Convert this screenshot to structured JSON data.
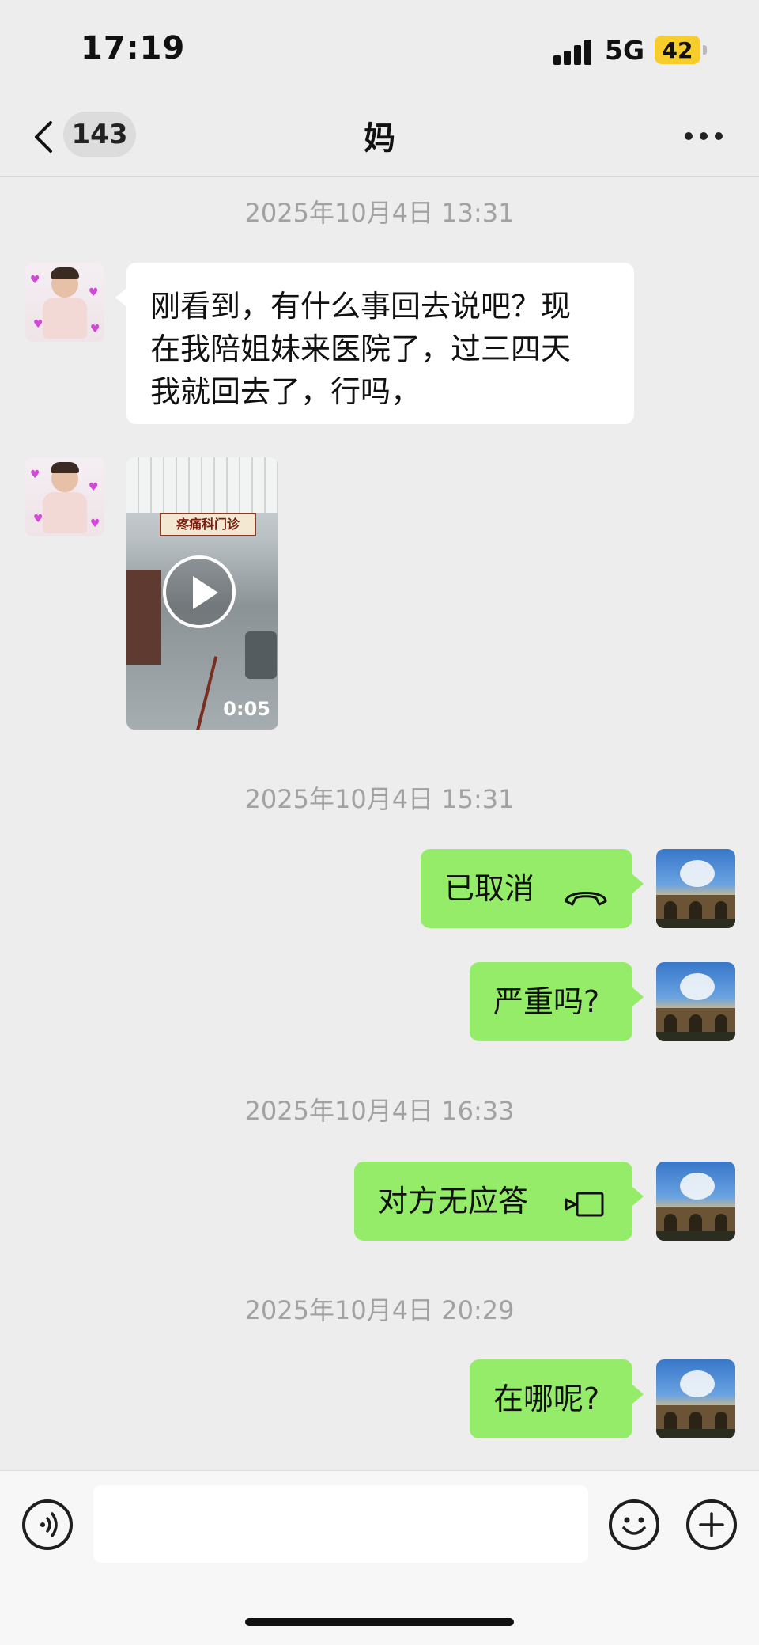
{
  "status_bar": {
    "time": "17:19",
    "network": "5G",
    "battery": "42"
  },
  "header": {
    "unread_count": "143",
    "title": "妈"
  },
  "messages": [
    {
      "type": "timestamp",
      "text": "2025年10月4日 13:31"
    },
    {
      "type": "text",
      "side": "left",
      "text": "刚看到，有什么事回去说吧？现\n在我陪姐妹来医院了，过三四天\n我就回去了，行吗，"
    },
    {
      "type": "video",
      "side": "left",
      "sign_text": "疼痛科门诊",
      "duration": "0:05"
    },
    {
      "type": "timestamp",
      "text": "2025年10月4日 15:31"
    },
    {
      "type": "call",
      "side": "right",
      "text": "已取消",
      "icon": "phone-hangup-icon"
    },
    {
      "type": "text",
      "side": "right",
      "text": "严重吗?"
    },
    {
      "type": "timestamp",
      "text": "2025年10月4日 16:33"
    },
    {
      "type": "call",
      "side": "right",
      "text": "对方无应答",
      "icon": "video-call-icon"
    },
    {
      "type": "timestamp",
      "text": "2025年10月4日 20:29"
    },
    {
      "type": "text",
      "side": "right",
      "text": "在哪呢?"
    }
  ],
  "input_bar": {
    "placeholder": "",
    "value": ""
  },
  "colors": {
    "background": "#ededed",
    "outgoing_bubble": "#95ec69",
    "incoming_bubble": "#ffffff",
    "timestamp": "#a2a2a2",
    "battery": "#f6cd2b"
  }
}
